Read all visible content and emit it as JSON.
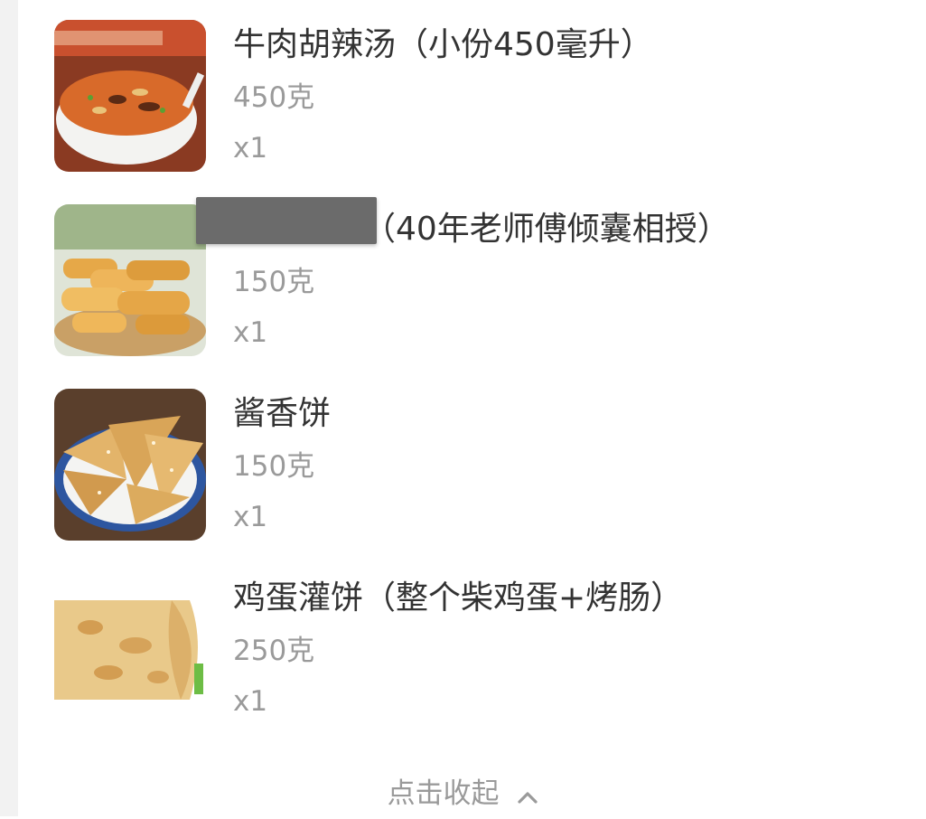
{
  "items": [
    {
      "name": "牛肉胡辣汤（小份450毫升）",
      "weight": "450克",
      "qty": "x1",
      "image_icon": "hot-soup-bowl"
    },
    {
      "name": "特色油馍（40年老师傅倾囊相授）",
      "weight": "150克",
      "qty": "x1",
      "image_icon": "fried-dough-basket"
    },
    {
      "name": "酱香饼",
      "weight": "150克",
      "qty": "x1",
      "image_icon": "sauce-pancake-plate"
    },
    {
      "name": "鸡蛋灌饼（整个柴鸡蛋+烤肠）",
      "weight": "250克",
      "qty": "x1",
      "image_icon": "egg-pancake-roll"
    }
  ],
  "footer": {
    "collapse_label": "点击收起",
    "collapse_icon": "chevron-up-icon"
  },
  "colors": {
    "title": "#333333",
    "meta": "#9a9a9a",
    "redaction": "#6b6b6b"
  }
}
